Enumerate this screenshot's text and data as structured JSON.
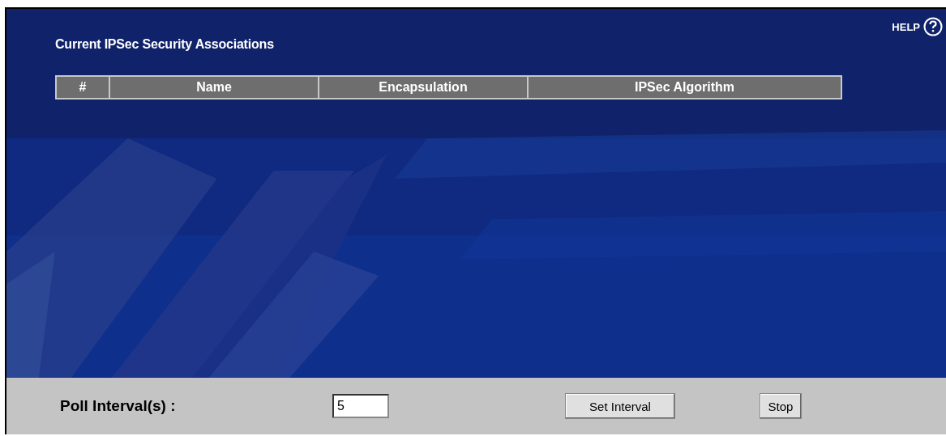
{
  "title": "Current IPSec Security Associations",
  "help": {
    "label": "HELP"
  },
  "table": {
    "columns": [
      "#",
      "Name",
      "Encapsulation",
      "IPSec Algorithm"
    ]
  },
  "poll": {
    "label": "Poll Interval(s) :",
    "value": "5"
  },
  "buttons": [
    "Set Interval",
    "Stop"
  ]
}
